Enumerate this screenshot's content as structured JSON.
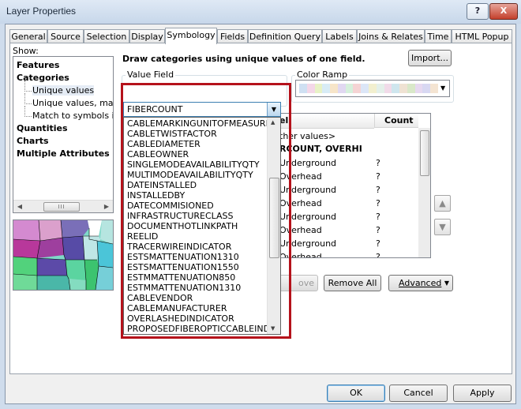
{
  "window": {
    "title": "Layer Properties",
    "help_label": "?",
    "close_label": "X"
  },
  "tabs": [
    {
      "label": "General"
    },
    {
      "label": "Source"
    },
    {
      "label": "Selection"
    },
    {
      "label": "Display"
    },
    {
      "label": "Symbology",
      "active": true
    },
    {
      "label": "Fields"
    },
    {
      "label": "Definition Query"
    },
    {
      "label": "Labels"
    },
    {
      "label": "Joins & Relates"
    },
    {
      "label": "Time"
    },
    {
      "label": "HTML Popup"
    }
  ],
  "show": {
    "label": "Show:",
    "items": [
      {
        "label": "Features",
        "bold": true
      },
      {
        "label": "Categories",
        "bold": true
      },
      {
        "label": "Unique values",
        "selected": true
      },
      {
        "label": "Unique values, many"
      },
      {
        "label": "Match to symbols in a"
      },
      {
        "label": "Quantities",
        "bold": true
      },
      {
        "label": "Charts",
        "bold": true
      },
      {
        "label": "Multiple Attributes",
        "bold": true
      }
    ],
    "scroll_thumb": "III"
  },
  "symbology": {
    "heading": "Draw categories using unique values of one field.",
    "import_label": "Import...",
    "value_field_label": "Value Field",
    "value_field_value": "FIBERCOUNT",
    "color_ramp_label": "Color Ramp",
    "color_ramp_colors": [
      "#cfe0f2",
      "#f4d7e8",
      "#e8f2c6",
      "#d8ecf6",
      "#f7e5c9",
      "#e1d8f1",
      "#d6f0dc",
      "#f5d4d4",
      "#dce6f7",
      "#f2efcf",
      "#e4f0ea",
      "#f1dbe9",
      "#cfe6ee",
      "#efe2d3",
      "#d9e8c9",
      "#e7d9f0",
      "#d8d8f2",
      "#f4e4d2"
    ],
    "table": {
      "col_label": "el",
      "col_count": "Count",
      "rows": [
        {
          "label": "ther values>",
          "count": ""
        },
        {
          "label": "RCOUNT, OVERHI",
          "count": "",
          "bold": true
        },
        {
          "label": "Underground",
          "count": "?"
        },
        {
          "label": "Overhead",
          "count": "?"
        },
        {
          "label": "Underground",
          "count": "?"
        },
        {
          "label": "Overhead",
          "count": "?"
        },
        {
          "label": "Underground",
          "count": "?"
        },
        {
          "label": "Overhead",
          "count": "?"
        },
        {
          "label": "Underground",
          "count": "?"
        },
        {
          "label": "Overhead",
          "count": "?"
        }
      ]
    },
    "remove_label": "ove",
    "remove_all_label": "Remove All",
    "advanced_label": "Advanced",
    "fields_dropdown": [
      "CABLEMARKINGUNITOFMEASURE",
      "CABLETWISTFACTOR",
      "CABLEDIAMETER",
      "CABLEOWNER",
      "SINGLEMODEAVAILABILITYQTY",
      "MULTIMODEAVAILABILITYQTY",
      "DATEINSTALLED",
      "INSTALLEDBY",
      "DATECOMMISIONED",
      "INFRASTRUCTURECLASS",
      "DOCUMENTHOTLINKPATH",
      "REELID",
      "TRACERWIREINDICATOR",
      "ESTSMATTENUATION1310",
      "ESTSMATTENUATION1550",
      "ESTMMATTENUATION850",
      "ESTMMATTENUATION1310",
      "CABLEVENDOR",
      "CABLEMANUFACTURER",
      "OVERLASHEDINDICATOR",
      "PROPOSEDFIBEROPTICCABLEIND"
    ]
  },
  "footer": {
    "ok_label": "OK",
    "cancel_label": "Cancel",
    "apply_label": "Apply"
  }
}
